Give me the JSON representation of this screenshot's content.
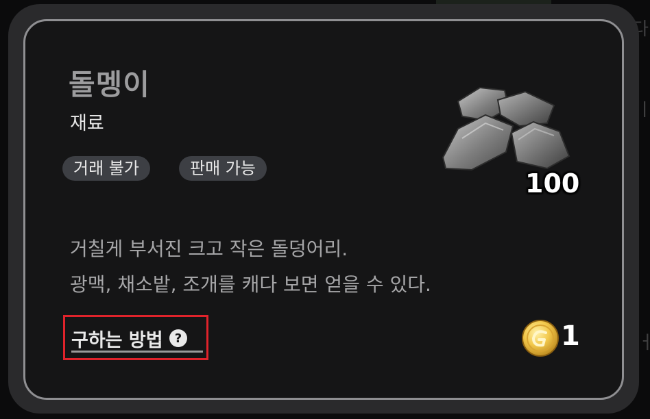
{
  "item": {
    "name": "돌멩이",
    "category": "재료",
    "tags": [
      "거래 불가",
      "판매 가능"
    ],
    "icon": "stone-pile-icon",
    "count": "100",
    "description": [
      "거칠게 부서진 크고 작은 돌덩어리.",
      "광맥, 채소밭, 조개를 캐다 보면 얻을 수 있다."
    ],
    "obtain_label": "구하는 방법",
    "price": "1",
    "price_icon": "gold-coin-icon"
  },
  "colors": {
    "highlight_box": "#e0232b",
    "card_border": "#8f8f92",
    "tag_background": "#3d3f44"
  }
}
